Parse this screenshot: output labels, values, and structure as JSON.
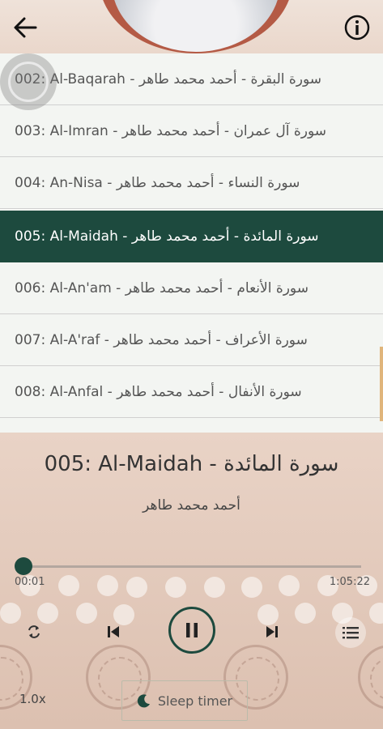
{
  "header": {
    "back_icon": "arrow-left-icon",
    "info_icon": "info-circle-icon"
  },
  "list": {
    "items": [
      {
        "number": "002",
        "name": "Al-Baqarah",
        "arabic_name": "سورة البقرة",
        "reciter": "أحمد محمد طاهر",
        "active": false
      },
      {
        "number": "003",
        "name": "Al-Imran",
        "arabic_name": "سورة آل عمران",
        "reciter": "أحمد محمد طاهر",
        "active": false
      },
      {
        "number": "004",
        "name": "An-Nisa",
        "arabic_name": "سورة النساء",
        "reciter": "أحمد محمد طاهر",
        "active": false
      },
      {
        "number": "005",
        "name": "Al-Maidah",
        "arabic_name": "سورة المائدة",
        "reciter": "أحمد محمد طاهر",
        "active": true
      },
      {
        "number": "006",
        "name": "Al-An'am",
        "arabic_name": "سورة الأنعام",
        "reciter": "أحمد محمد طاهر",
        "active": false
      },
      {
        "number": "007",
        "name": "Al-A'raf",
        "arabic_name": "سورة الأعراف",
        "reciter": "أحمد محمد طاهر",
        "active": false
      },
      {
        "number": "008",
        "name": "Al-Anfal",
        "arabic_name": "سورة الأنفال",
        "reciter": "أحمد محمد طاهر",
        "active": false
      }
    ]
  },
  "player": {
    "title": "005: Al-Maidah - سورة المائدة",
    "reciter": "أحمد محمد طاهر",
    "current_time": "00:01",
    "total_time": "1:05:22",
    "progress": 0.003,
    "speed": "1.0x",
    "sleep_label": "Sleep timer",
    "accent_color": "#1d4a3e",
    "icons": {
      "repeat": "repeat-icon",
      "previous": "skip-previous-icon",
      "pause": "pause-icon",
      "next": "skip-next-icon",
      "playlist": "playlist-icon",
      "sleep": "moon-icon"
    }
  }
}
